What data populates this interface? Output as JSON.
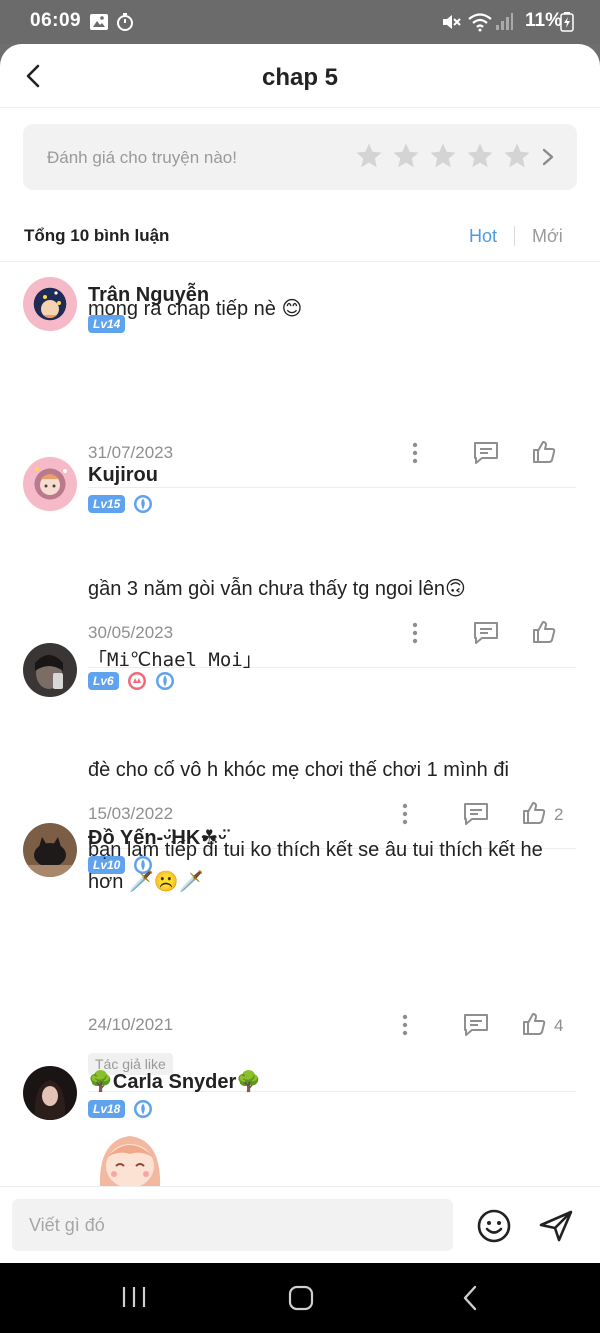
{
  "status_bar": {
    "time": "06:09",
    "battery": "11%"
  },
  "header": {
    "title": "chap 5"
  },
  "rating": {
    "prompt": "Đánh giá cho truyện nào!",
    "stars": 5
  },
  "comments_header": {
    "count_label": "Tổng 10 bình luận",
    "sort_hot": "Hot",
    "sort_new": "Mới"
  },
  "comments": [
    {
      "username": "Trân Nguyễn",
      "level": "Lv14",
      "text": "mong ra chap tiếp nè 😊",
      "date": "31/07/2023",
      "likes": ""
    },
    {
      "username": "Kujirou",
      "level": "Lv15",
      "text": "gần 3 năm gòi vẫn chưa thấy tg ngoi lên🙃",
      "date": "30/05/2023",
      "likes": ""
    },
    {
      "username": "「Mi℃hael Moi」",
      "level": "Lv6",
      "text": "đè cho cố vô h khóc mẹ chơi thế chơi 1 mình đi",
      "date": "15/03/2022",
      "likes": "2"
    },
    {
      "username": "Đồ Yến-ᵕ̈HK☘ᵕ̈",
      "level": "Lv10",
      "text": "bạn làm tiếp đi tui ko thích kết se âu tui thích kết he hơn 🗡️☹️🗡️",
      "date": "24/10/2021",
      "likes": "4",
      "tag": "Tác giả like"
    },
    {
      "username": "🌳Carla Snyder🌳",
      "level": "Lv18"
    }
  ],
  "input": {
    "placeholder": "Viết gì đó"
  },
  "colors": {
    "accent": "#4a9be8",
    "level_badge": "#5fa3ee",
    "muted": "#8f8f8f"
  }
}
